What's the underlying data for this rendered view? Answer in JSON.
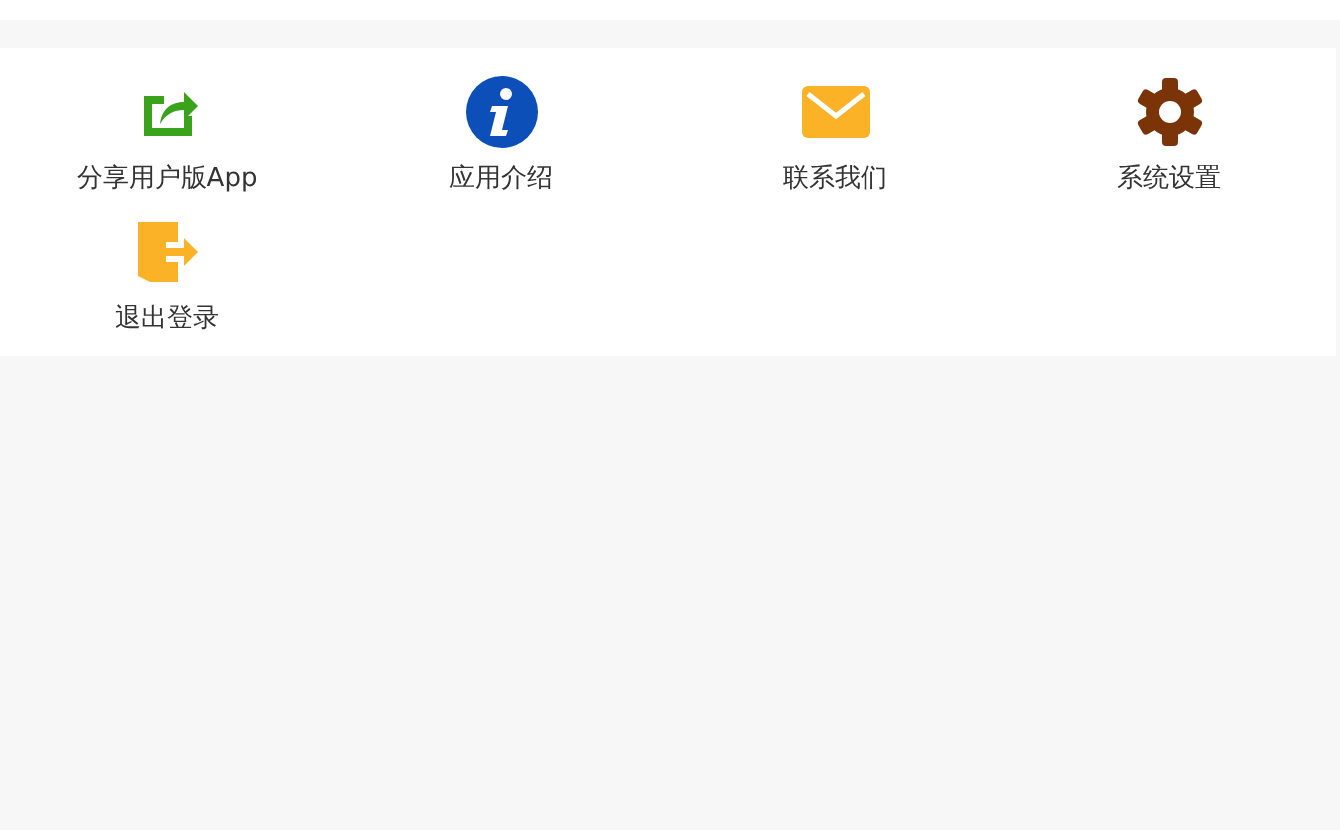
{
  "menu": {
    "items": [
      {
        "label": "分享用户版App"
      },
      {
        "label": "应用介绍"
      },
      {
        "label": "联系我们"
      },
      {
        "label": "系统设置"
      },
      {
        "label": "退出登录"
      }
    ]
  }
}
